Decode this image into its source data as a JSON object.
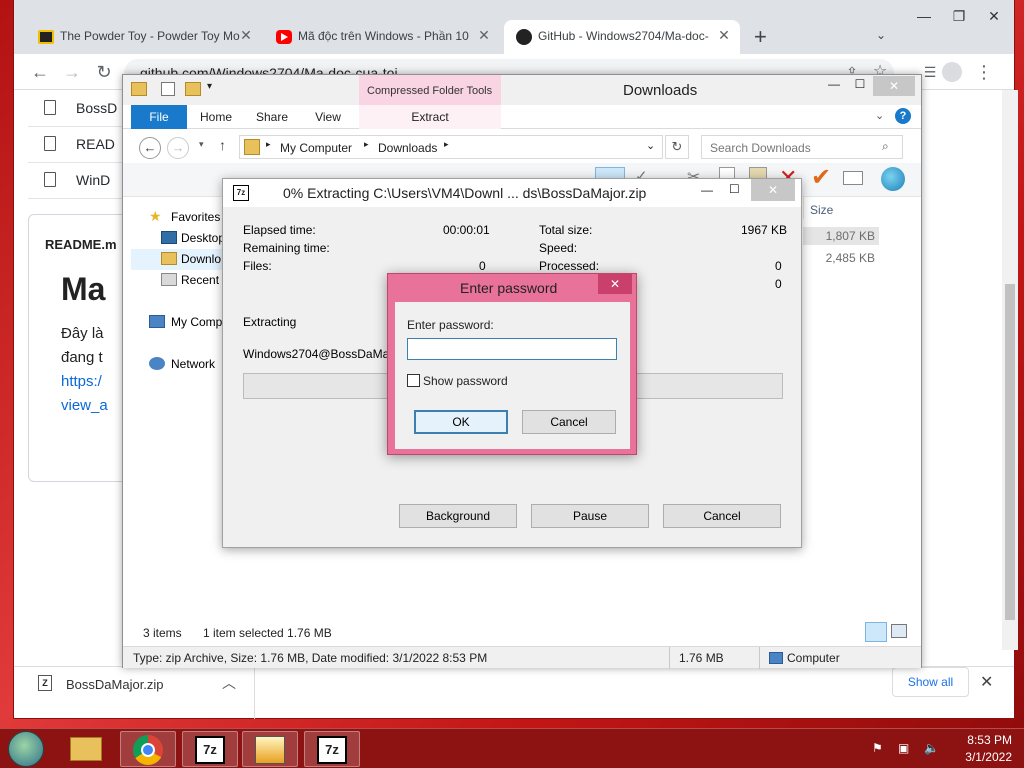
{
  "browser": {
    "tabs": [
      {
        "label": "The Powder Toy - Powder Toy Mo",
        "favicon": "powder-toy-icon"
      },
      {
        "label": "Mã độc trên Windows - Phần 10",
        "favicon": "youtube-icon"
      },
      {
        "label": "GitHub - Windows2704/Ma-doc-",
        "favicon": "github-icon"
      }
    ],
    "new_tab": "+",
    "url": "github.com/Windows2704/Ma-doc-cua-toi",
    "files": [
      "BossD",
      "READ",
      "WinD"
    ],
    "readme_label": "README.m",
    "readme_heading": "Ma",
    "readme_lines": [
      "Đây là",
      "đang t",
      "https:/",
      "view_a"
    ],
    "shelf": {
      "download_name": "BossDaMajor.zip",
      "show_all": "Show all"
    }
  },
  "explorer": {
    "title": "Downloads",
    "context_tab": "Compressed Folder Tools",
    "ribbon_tabs": [
      "File",
      "Home",
      "Share",
      "View"
    ],
    "context_subtab": "Extract",
    "breadcrumb": [
      "My Computer",
      "Downloads"
    ],
    "search_placeholder": "Search Downloads",
    "nav": {
      "favorites": "Favorites",
      "desktop": "Desktop",
      "downloads": "Downlo",
      "recent": "Recent p",
      "computer": "My Comp",
      "network": "Network"
    },
    "column_size": "Size",
    "sizes": [
      "1,807 KB",
      "2,485 KB"
    ],
    "status_items": "3 items",
    "status_selected": "1 item selected  1.76 MB",
    "details_text": "Type: zip Archive, Size: 1.76 MB, Date modified: 3/1/2022 8:53 PM",
    "details_size": "1.76 MB",
    "details_location": "Computer"
  },
  "sevenzip": {
    "title": "0% Extracting C:\\Users\\VM4\\Downl ... ds\\BossDaMajor.zip",
    "elapsed_label": "Elapsed time:",
    "elapsed_value": "00:00:01",
    "remaining_label": "Remaining time:",
    "files_label": "Files:",
    "files_value": "0",
    "total_size_label": "Total size:",
    "total_size_value": "1967 KB",
    "speed_label": "Speed:",
    "processed_label": "Processed:",
    "processed_value": "0",
    "extra_value": "0",
    "extracting_label": "Extracting",
    "current_file": "Windows2704@BossDaMajor.",
    "progress": 0,
    "btn_background": "Background",
    "btn_pause": "Pause",
    "btn_cancel": "Cancel"
  },
  "password_dialog": {
    "title": "Enter password",
    "field_label": "Enter password:",
    "value": "",
    "show_password": "Show password",
    "ok": "OK",
    "cancel": "Cancel",
    "accent": "#e8729a"
  },
  "taskbar": {
    "time": "8:53 PM",
    "date": "3/1/2022"
  }
}
